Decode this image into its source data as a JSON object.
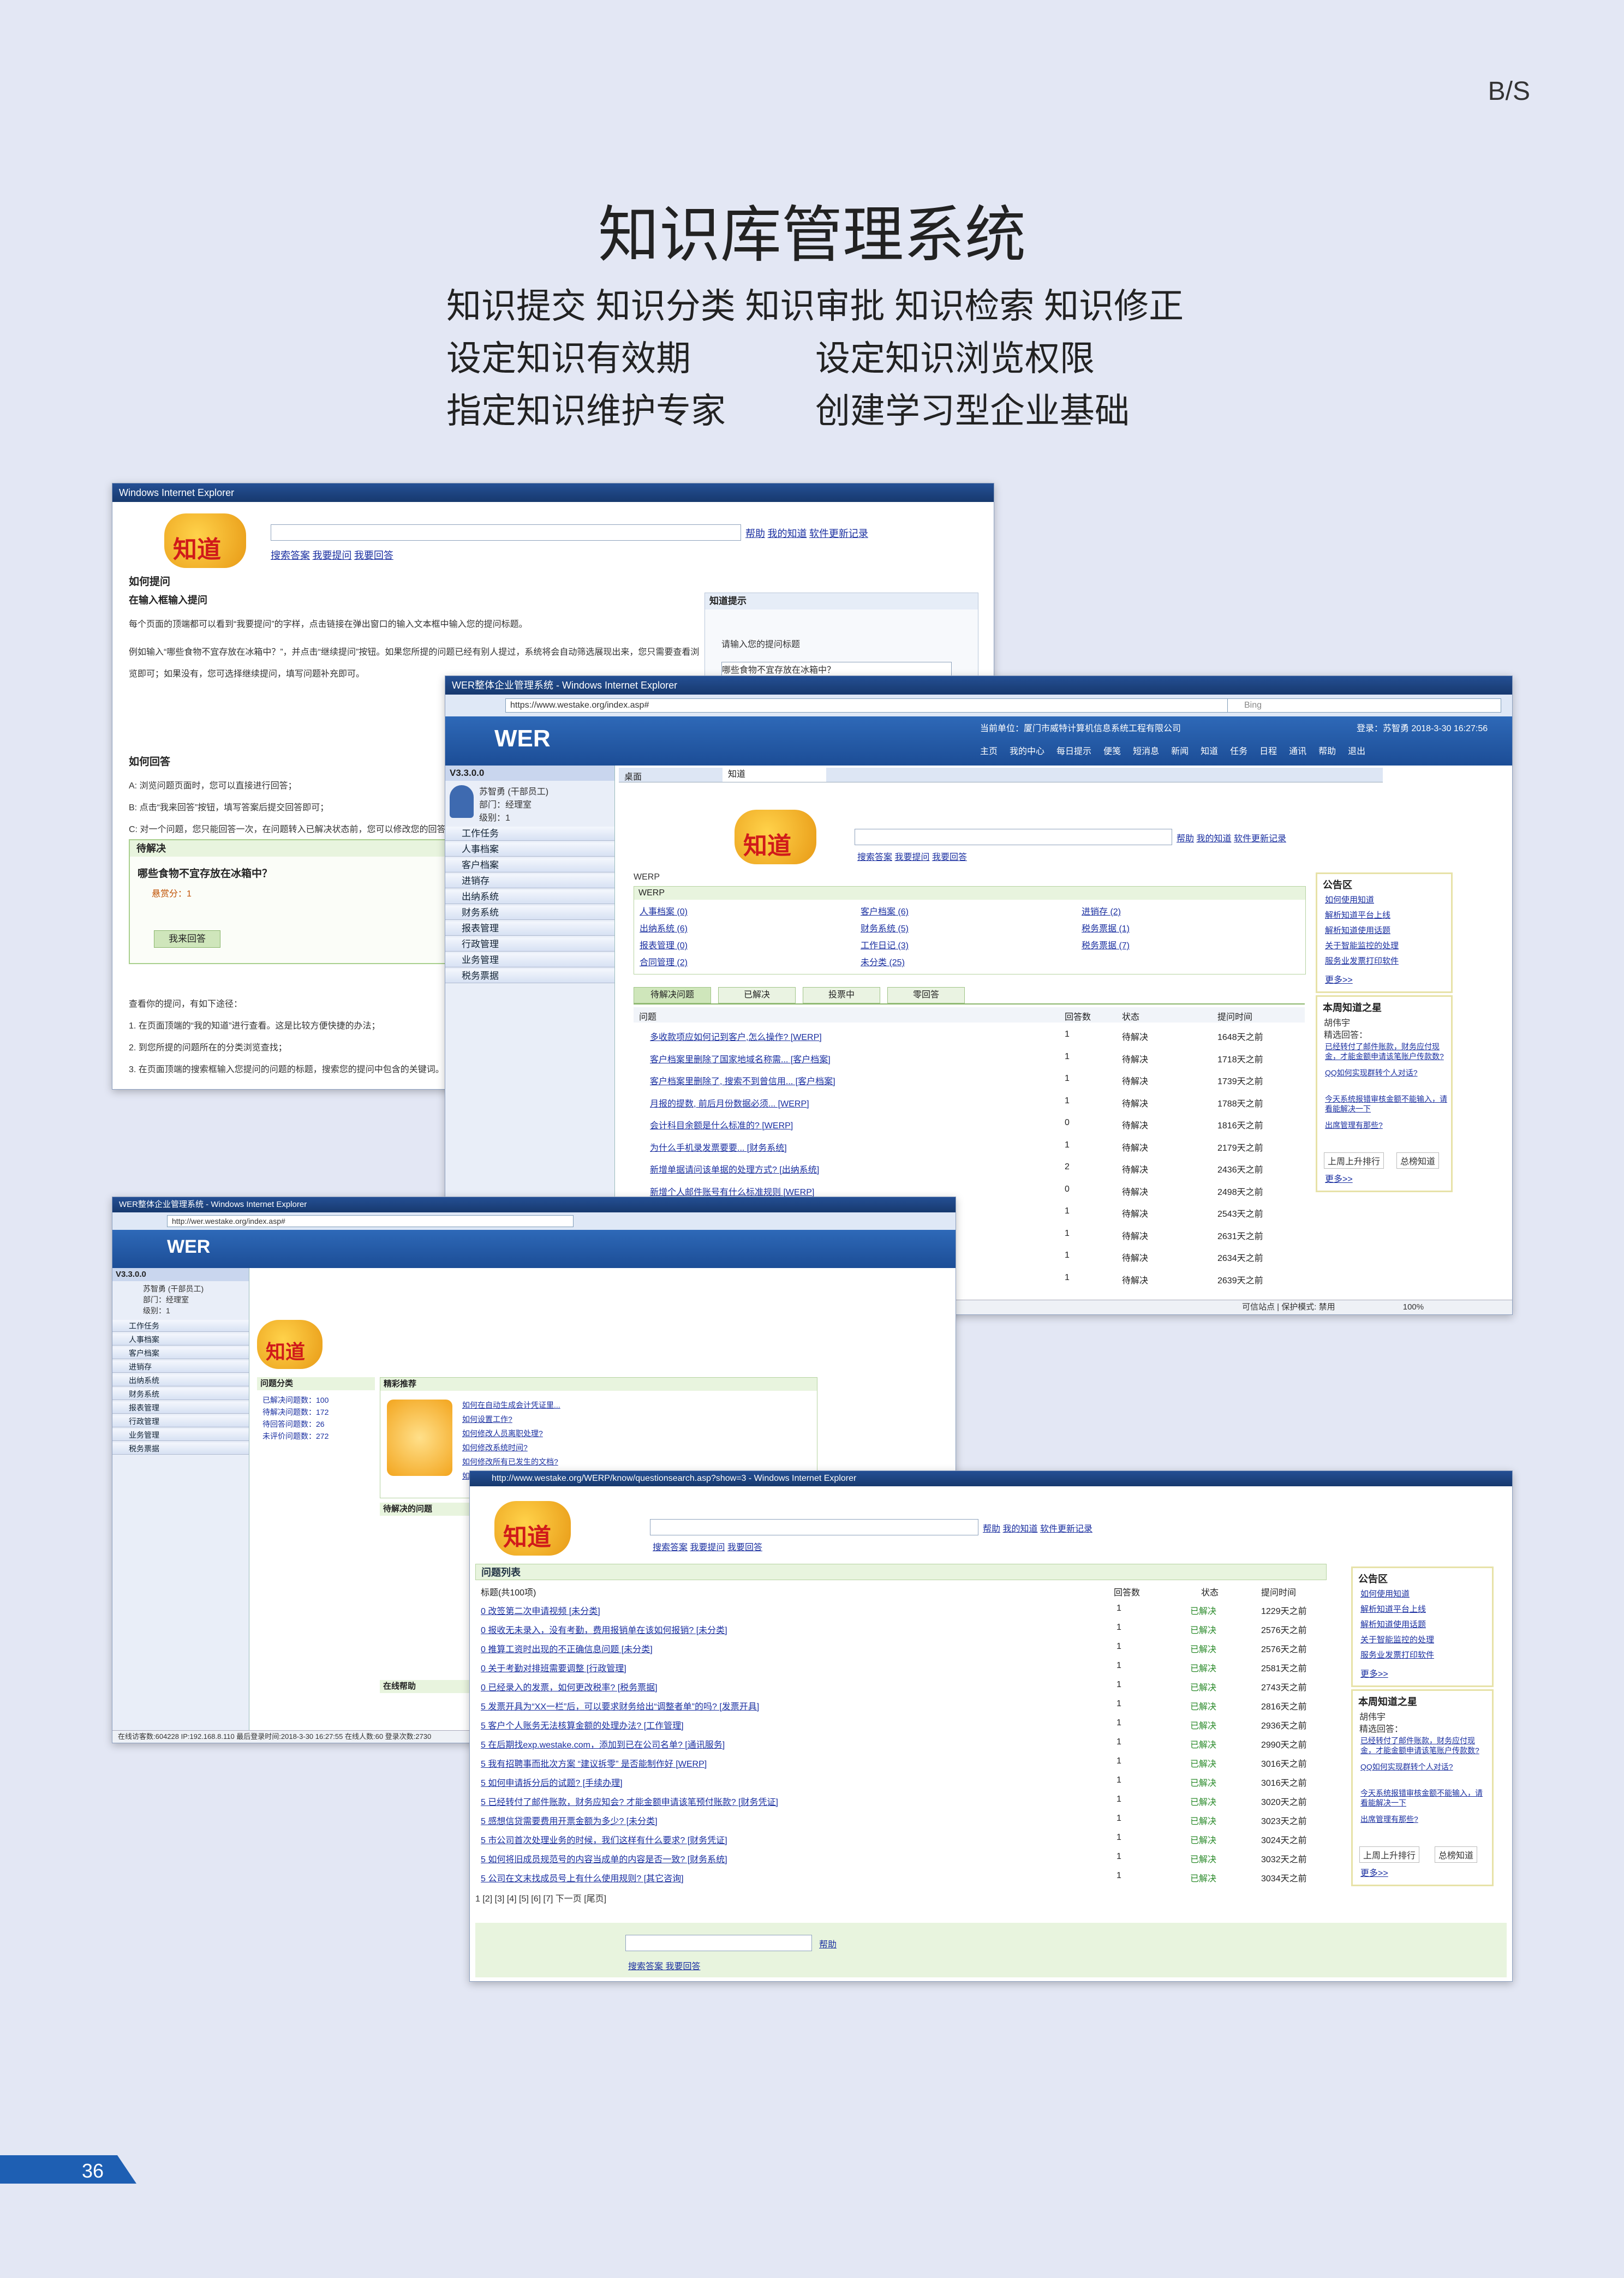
{
  "tag": "B/S",
  "title": "知识库管理系统",
  "features": {
    "line1": "知识提交  知识分类  知识审批  知识检索  知识修正",
    "line2a": "设定知识有效期",
    "line2b": "设定知识浏览权限",
    "line3a": "指定知识维护专家",
    "line3b": "创建学习型企业基础"
  },
  "shot1": {
    "ie_title": "Windows Internet Explorer",
    "logo_text": "知道",
    "links": [
      "帮助",
      "我的知道",
      "软件更新记录"
    ],
    "tabs": [
      "搜索答案",
      "我要提问",
      "我要回答"
    ],
    "section1": "如何提问",
    "sub1": "在输入框输入提问",
    "para1": "每个页面的顶端都可以看到“我要提问”的字样，点击链接在弹出窗口的输入文本框中输入您的提问标题。",
    "para2": "例如输入“哪些食物不宜存放在冰箱中？”，并点击“继续提问”按钮。如果您所提的问题已经有别人提过，系统将会自动筛选展现出来，您只需要查看浏览即可；如果没有，您可选择继续提问，填写问题补充即可。",
    "popup_title": "知道提示",
    "popup_hint": "请输入您的提问标题",
    "popup_input": "哪些食物不宜存放在冰箱中？",
    "section2": "如何回答",
    "ans_a": "A: 浏览问题页面时，您可以直接进行回答；",
    "ans_b": "B: 点击“我来回答”按钮，填写答案后提交回答即可；",
    "ans_c": "C: 对一个问题，您只能回答一次，在问题转入已解决状态前，您可以修改您的回答。",
    "pending": "待解决",
    "question": "哪些食物不宜存放在冰箱中？",
    "score": "悬赏分：1",
    "answer_btn": "我来回答",
    "view_intro": "查看你的提问，有如下途径：",
    "view1": "1. 在页面顶端的“我的知道”进行查看。这是比较方便快捷的办法；",
    "view2": "2. 到您所提的问题所在的分类浏览查找；",
    "view3": "3. 在页面顶端的搜索框输入您提问的问题的标题，搜索您的提问中包含的关键词。"
  },
  "shot2": {
    "ie_title": "WER整体企业管理系统 - Windows Internet Explorer",
    "url": "https://www.westake.org/index.asp#",
    "ie_search": "Bing",
    "brand": "WER",
    "company": "当前单位：厦门市威特计算机信息系统工程有限公司",
    "login": "登录：苏智勇  2018-3-30 16:27:56",
    "toolbar": [
      "主页",
      "我的中心",
      "每日提示",
      "便笺",
      "短消息",
      "新闻",
      "知道",
      "任务",
      "日程",
      "通讯",
      "帮助",
      "退出"
    ],
    "version": "V3.3.0.0",
    "user_name": "苏智勇 (干部员工)",
    "dept": "部门：经理室",
    "level": "级别：1",
    "menu": [
      "工作任务",
      "人事档案",
      "客户档案",
      "进销存",
      "出纳系统",
      "财务系统",
      "报表管理",
      "行政管理",
      "业务管理",
      "税务票据"
    ],
    "tabs": [
      "桌面",
      "知道"
    ],
    "logo_text": "知道",
    "links": [
      "帮助",
      "我的知道",
      "软件更新记录"
    ],
    "search_tabs": [
      "搜索答案",
      "我要提问",
      "我要回答"
    ],
    "werp": "WERP",
    "categories": [
      "人事档案 (0)",
      "客户档案 (6)",
      "进销存 (2)",
      "出纳系统 (6)",
      "财务系统 (5)",
      "税务票据 (1)",
      "报表管理 (0)",
      "工作日记 (3)",
      "税务票据 (7)",
      "合同管理 (2)",
      "未分类 (25)"
    ],
    "list_tabs": [
      "待解决问题",
      "已解决",
      "投票中",
      "零回答"
    ],
    "col_headers": [
      "问题",
      "回答数",
      "状态",
      "提问时间"
    ],
    "rows": [
      [
        "多收款项应如何记到客户,怎么操作?  [WERP]",
        "1",
        "待解决",
        "1648天之前"
      ],
      [
        "客户档案里删除了国家地域名称需...  [客户档案]",
        "1",
        "待解决",
        "1718天之前"
      ],
      [
        "客户档案里删除了, 搜索不到曾信用...  [客户档案]",
        "1",
        "待解决",
        "1739天之前"
      ],
      [
        "月报的提数, 前后月份数据必须...  [WERP]",
        "1",
        "待解决",
        "1788天之前"
      ],
      [
        "会计科目余额是什么标准的?  [WERP]",
        "0",
        "待解决",
        "1816天之前"
      ],
      [
        "为什么手机录发票要要...  [财务系统]",
        "1",
        "待解决",
        "2179天之前"
      ],
      [
        "新增单据请问该单据的处理方式?  [出纳系统]",
        "2",
        "待解决",
        "2436天之前"
      ],
      [
        "新增个人邮件账号有什么标准规则  [WERP]",
        "0",
        "待解决",
        "2498天之前"
      ],
      [
        "",
        "1",
        "待解决",
        "2543天之前"
      ],
      [
        "",
        "1",
        "待解决",
        "2631天之前"
      ],
      [
        "",
        "1",
        "待解决",
        "2634天之前"
      ],
      [
        "",
        "1",
        "待解决",
        "2639天之前"
      ]
    ],
    "notice_title": "公告区",
    "notices": [
      "如何使用知道",
      "解析知道平台上线",
      "解析知道使用话题",
      "关于智能监控的处理",
      "服务业发票打印软件"
    ],
    "more": "更多>>",
    "star_title": "本周知道之星",
    "star_name": "胡伟宇",
    "star_sub": "精选回答：",
    "star_items": [
      "已经转付了邮件账款，财务应付现金，才能金额申请该笔账户传款数?",
      "QQ如何实现群转个人对话?",
      "今天系统报错审核金额不能输入，请看能解决一下",
      "出席管理有那些?"
    ],
    "rank_tabs": [
      "上周上升排行",
      "总榜知道"
    ],
    "status": "可信站点 | 保护模式: 禁用",
    "zoom": "100%"
  },
  "shot3": {
    "ie_title": "WER整体企业管理系统 - Windows Internet Explorer",
    "url": "http://wer.westake.org/index.asp#",
    "brand": "WER",
    "version": "V3.3.0.0",
    "user_name": "苏智勇 (干部员工)",
    "dept": "部门：经理室",
    "level": "级别：1",
    "menu": [
      "工作任务",
      "人事档案",
      "客户档案",
      "进销存",
      "出纳系统",
      "财务系统",
      "报表管理",
      "行政管理",
      "业务管理",
      "税务票据"
    ],
    "logo_text": "知道",
    "cat_title": "问题分类",
    "stats": [
      "已解决问题数：100",
      "待解决问题数：172",
      "待回答问题数：26",
      "未评价问题数：272"
    ],
    "featured": "精彩推荐",
    "featured_items": [
      "如何在自动生成会计凭证里...",
      "如何设置工作?",
      "如何修改人员离职处理?",
      "如何修改系统时间?",
      "如何修改所有已发生的文档?",
      "如何修改多部门分类?"
    ],
    "pending_title": "待解决的问题",
    "helper_title": "在线帮助",
    "status": "在线访客数:604228  IP:192.168.8.110  最后登录时间:2018-3-30 16:27:55  在线人数:60  登录次数:2730"
  },
  "shot4": {
    "ie_title": "http://www.westake.org/WERP/know/questionsearch.asp?show=3 - Windows Internet Explorer",
    "logo_text": "知道",
    "links": [
      "帮助",
      "我的知道",
      "软件更新记录"
    ],
    "search_tabs": [
      "搜索答案",
      "我要提问",
      "我要回答"
    ],
    "list_title": "问题列表",
    "total": "标题(共100项)",
    "col_headers": [
      "回答数",
      "状态",
      "提问时间"
    ],
    "rows": [
      [
        "0 改签第二次申请视频 [未分类]",
        "1",
        "已解决",
        "1229天之前"
      ],
      [
        "0 报收无未录入，没有考勤，费用报销单在该如何报销? [未分类]",
        "1",
        "已解决",
        "2576天之前"
      ],
      [
        "0 推算工资时出现的不正确信息问题 [未分类]",
        "1",
        "已解决",
        "2576天之前"
      ],
      [
        "0 关于考勤对排班需要调整 [行政管理]",
        "1",
        "已解决",
        "2581天之前"
      ],
      [
        "0 已经录入的发票，如何更改税率? [税务票据]",
        "1",
        "已解决",
        "2743天之前"
      ],
      [
        "5 发票开具为“XX一栏”后，可以要求财务给出“调整者单”的吗? [发票开具]",
        "1",
        "已解决",
        "2816天之前"
      ],
      [
        "5 客户个人账务无法核算金额的处理办法? [工作管理]",
        "1",
        "已解决",
        "2936天之前"
      ],
      [
        "5 在后期找exp.westake.com，添加到已在公司名单? [通讯服务]",
        "1",
        "已解决",
        "2990天之前"
      ],
      [
        "5 我有招聘事而批次方案 “建议拆零” 是否能制作好 [WERP]",
        "1",
        "已解决",
        "3016天之前"
      ],
      [
        "5 如何申请拆分后的试题? [手续办理]",
        "1",
        "已解决",
        "3016天之前"
      ],
      [
        "5 已经转付了邮件账款，财务应知会? 才能金额申请该笔预付账款? [财务凭证]",
        "1",
        "已解决",
        "3020天之前"
      ],
      [
        "5 感想信贷需要费用开票金额为多少? [未分类]",
        "1",
        "已解决",
        "3023天之前"
      ],
      [
        "5 市公司首次处理业务的时候，我们这样有什么要求? [财务凭证]",
        "1",
        "已解决",
        "3024天之前"
      ],
      [
        "5 如何将旧成员规范号的内容当成单的内容是否一致? [财务系统]",
        "1",
        "已解决",
        "3032天之前"
      ],
      [
        "5 公司在文末找成员号上有什么使用规则? [其它咨询]",
        "1",
        "已解决",
        "3034天之前"
      ]
    ],
    "pager": "1 [2] [3] [4] [5] [6] [7] 下一页 [尾页]",
    "notice_title": "公告区",
    "notices": [
      "如何使用知道",
      "解析知道平台上线",
      "解析知道使用话题",
      "关于智能监控的处理",
      "服务业发票打印软件"
    ],
    "more": "更多>>",
    "star_title": "本周知道之星",
    "star_name": "胡伟宇",
    "star_sub": "精选回答：",
    "star_items": [
      "已经转付了邮件账款，财务应付现金，才能金额申请该笔账户传款数?",
      "QQ如何实现群转个人对话?",
      "今天系统报错审核金额不能输入，请看能解决一下",
      "出席管理有那些?"
    ],
    "rank_tabs": [
      "上周上升排行",
      "总榜知道"
    ],
    "footer_btn": "帮助",
    "footer_links": "搜索答案  我要回答"
  },
  "page_number": "36",
  "colors": {
    "page_bg": "#e3e7f4",
    "accent": "#1e5fb3",
    "ie_bar": "#244f94",
    "green_panel": "#e8f4de"
  }
}
